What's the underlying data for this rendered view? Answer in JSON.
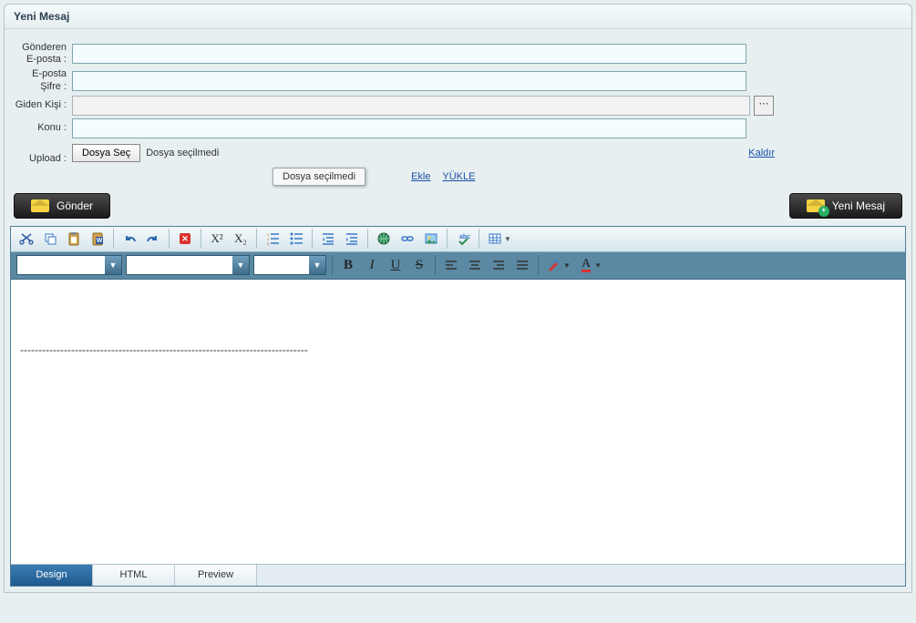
{
  "header": {
    "title": "Yeni Mesaj"
  },
  "form": {
    "sender_email_label": "Gönderen E-posta :",
    "email_password_label": "E-posta Şifre :",
    "recipient_label": "Giden Kişi :",
    "subject_label": "Konu :",
    "upload_label": "Upload :",
    "file_button": "Dosya Seç",
    "file_status": "Dosya seçilmedi",
    "remove_link": "Kaldır",
    "tooltip": "Dosya seçilmedi",
    "add_link": "Ekle",
    "upload_link": "YÜKLE",
    "sender_email_value": "",
    "email_password_value": "",
    "recipient_value": "",
    "subject_value": ""
  },
  "actions": {
    "send": "Gönder",
    "new_message": "Yeni Mesaj"
  },
  "editor": {
    "toolbar1": {
      "cut": "cut-icon",
      "copy": "copy-icon",
      "paste": "paste-icon",
      "paste_word": "paste-word-icon",
      "undo": "undo-icon",
      "redo": "redo-icon",
      "clear_format": "clear-format-icon",
      "superscript": "X²",
      "subscript": "X₂",
      "ordered_list": "ordered-list-icon",
      "unordered_list": "unordered-list-icon",
      "outdent": "outdent-icon",
      "indent": "indent-icon",
      "link": "link-icon",
      "unlink": "unlink-icon",
      "image": "image-icon",
      "spellcheck": "spellcheck-icon",
      "table": "table-icon"
    },
    "toolbar2": {
      "bold": "B",
      "italic": "I",
      "underline": "U",
      "strike": "S",
      "align_left": "align-left-icon",
      "align_center": "align-center-icon",
      "align_right": "align-right-icon",
      "align_justify": "align-justify-icon",
      "highlight": "highlight-icon",
      "font_color": "A"
    },
    "content_divider": "-------------------------------------------------------------------------------"
  },
  "tabs": {
    "design": "Design",
    "html": "HTML",
    "preview": "Preview",
    "active": "design"
  }
}
